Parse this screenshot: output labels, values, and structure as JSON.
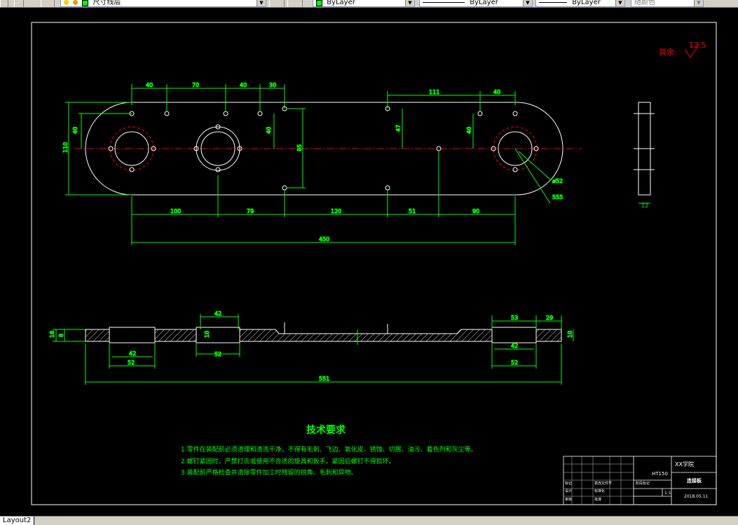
{
  "toolbar": {
    "layer_name": "尺寸线层",
    "color_value": "ByLayer",
    "linetype_value": "ByLayer",
    "lineweight_value": "ByLayer",
    "plotstyle_value": "随颜色"
  },
  "tabs": {
    "active": "Layout2"
  },
  "drawing": {
    "roughness": {
      "label": "其余:",
      "value": "12.5"
    },
    "plan_dims": {
      "top": [
        "40",
        "70",
        "40",
        "30",
        "111",
        "40"
      ],
      "left": [
        "110",
        "40"
      ],
      "inner": [
        "40",
        "47",
        "40",
        "85"
      ],
      "bottom": [
        "100",
        "79",
        "120",
        "51",
        "90"
      ],
      "overall": "450",
      "radius": "ø52",
      "leader": "555"
    },
    "side_dim": "12",
    "section_dims": {
      "left_h": [
        "16",
        "8"
      ],
      "top": [
        "42",
        "53",
        "29"
      ],
      "bottom": [
        "42",
        "52",
        "52",
        "42",
        "52"
      ],
      "mid_h": "10",
      "right_h": "10",
      "overall": "551"
    },
    "tech": {
      "title": "技术要求",
      "items": [
        "1.零件在装配前必须清理和清洗干净，不得有毛刺、飞边、氧化皮、锈蚀、切屑、油污、着色剂和灰尘等。",
        "2.螺钉紧固时，严禁打击或使用不合适的旋具和扳手。紧固后螺钉不得损坏。",
        "3.装配前严格检查并清除零件加工时残留的锐角、毛刺和异物。"
      ]
    },
    "titleblock": {
      "material": "HT150",
      "school": "XX学院",
      "name": "连接板",
      "scale": "1:1",
      "date": "2018.05.11",
      "small": [
        "标记",
        "处数",
        "分区",
        "更改文件号",
        "签名",
        "年月日",
        "设计",
        "标准化",
        "阶段标记",
        "重量",
        "比例",
        "审核",
        "工艺",
        "批准",
        "共 张",
        "第 张"
      ]
    }
  }
}
